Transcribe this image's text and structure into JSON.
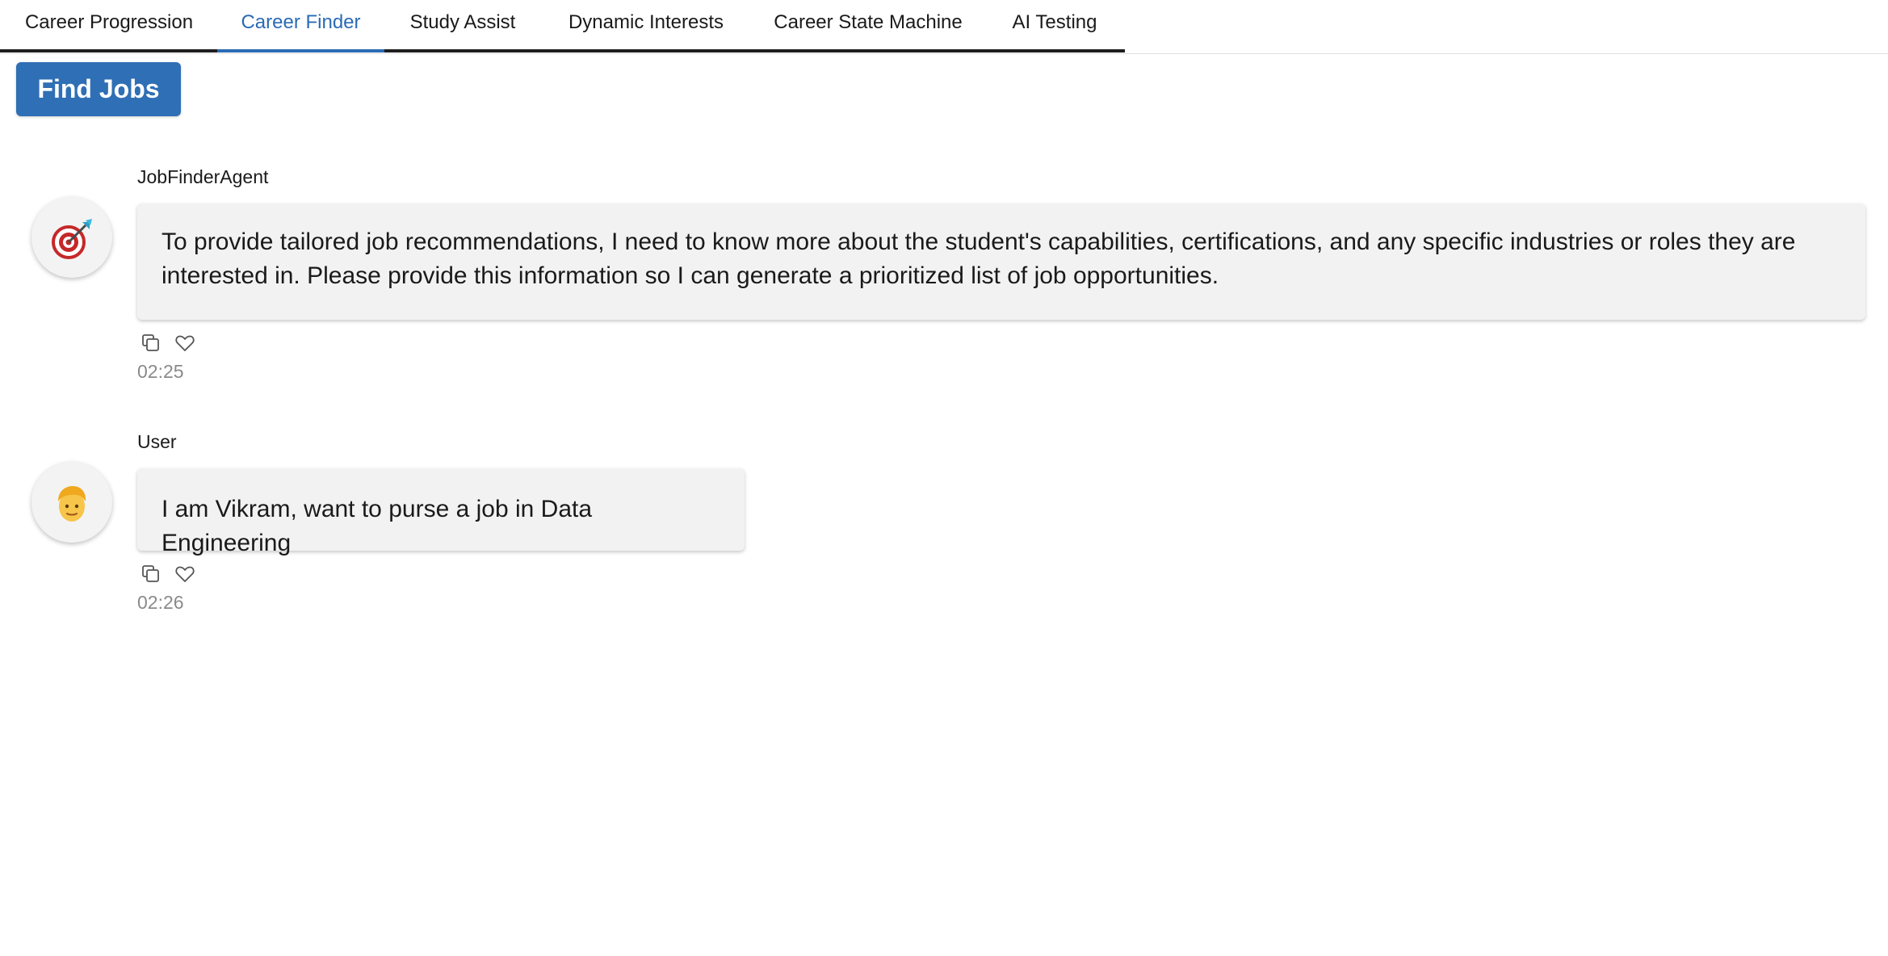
{
  "tabs": [
    {
      "label": "Career Progression"
    },
    {
      "label": "Career Finder"
    },
    {
      "label": "Study Assist"
    },
    {
      "label": "Dynamic Interests"
    },
    {
      "label": "Career State Machine"
    },
    {
      "label": "AI Testing"
    }
  ],
  "active_tab": "Career Finder",
  "find_jobs_label": "Find Jobs",
  "messages": [
    {
      "sender": "JobFinderAgent",
      "avatar_icon": "target-icon",
      "text": "To provide tailored job recommendations, I need to know more about the student's capabilities, certifications, and any specific industries or roles they are interested in. Please provide this information so I can generate a prioritized list of job opportunities.",
      "time": "02:25"
    },
    {
      "sender": "User",
      "avatar_icon": "person-icon",
      "text": "I am Vikram, want to purse a job in Data Engineering",
      "time": "02:26"
    }
  ],
  "colors": {
    "accent": "#2a6bb4",
    "button": "#2f6fb5",
    "bubble": "#f2f2f2",
    "timestamp": "#8a8a8a"
  }
}
